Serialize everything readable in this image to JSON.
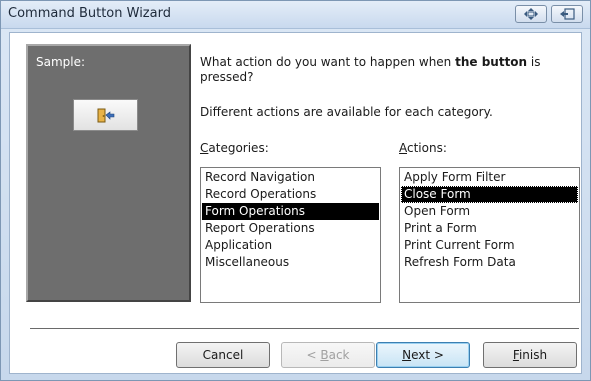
{
  "window": {
    "title": "Command Button Wizard"
  },
  "sample": {
    "label": "Sample:"
  },
  "prompt": {
    "text_before": "What action do you want to happen when ",
    "text_bold": "the button",
    "text_after": " is pressed?",
    "subtext": "Different actions are available for each category."
  },
  "categories": {
    "label_key": "C",
    "label_rest": "ategories:",
    "items": [
      "Record Navigation",
      "Record Operations",
      "Form Operations",
      "Report Operations",
      "Application",
      "Miscellaneous"
    ],
    "selected": "Form Operations"
  },
  "actions": {
    "label_key": "A",
    "label_rest": "ctions:",
    "items": [
      "Apply Form Filter",
      "Close Form",
      "Open Form",
      "Print a Form",
      "Print Current Form",
      "Refresh Form Data"
    ],
    "selected": "Close Form"
  },
  "buttons": {
    "cancel": {
      "label": "Cancel"
    },
    "back": {
      "pre": "< ",
      "key": "B",
      "rest": "ack"
    },
    "next": {
      "key": "N",
      "rest": "ext >"
    },
    "finish": {
      "key": "F",
      "rest": "inish"
    }
  },
  "icons": {
    "restore": "move-resize-icon",
    "exit": "exit-icon",
    "sample": "door-exit-icon"
  },
  "colors": {
    "selection": "#000000",
    "sample_panel": "#6e6e6e",
    "titlebar": "#c9d9ee"
  }
}
